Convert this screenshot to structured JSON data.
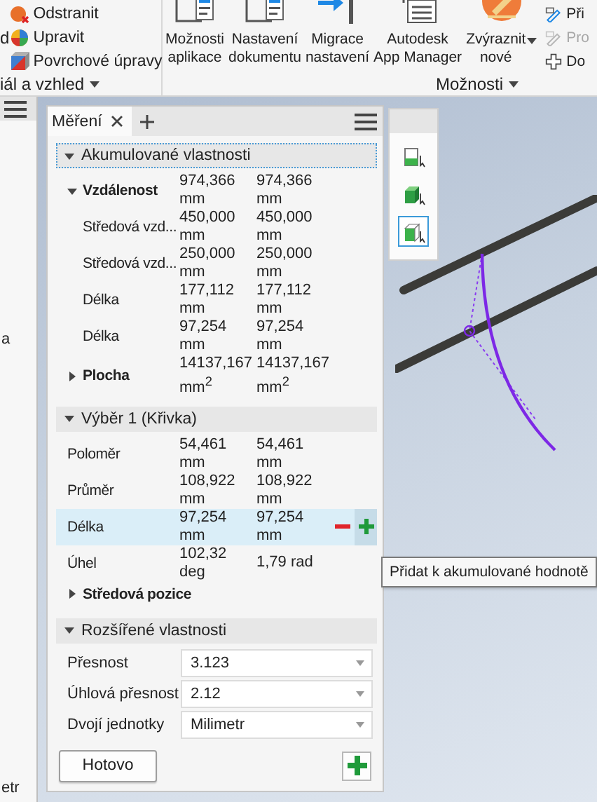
{
  "ribbon": {
    "material_group": {
      "cut_text": "d",
      "label": "iál a vzhled",
      "items": [
        {
          "label": "Odstranit",
          "kind": "remove"
        },
        {
          "label": "Upravit",
          "kind": "edit"
        },
        {
          "label": "Povrchové úpravy",
          "kind": "finish"
        }
      ]
    },
    "options_group": {
      "label": "Možnosti",
      "buttons": [
        {
          "label": "Možnosti\naplikace",
          "kind": "app-options",
          "dropdown": false
        },
        {
          "label": "Nastavení\ndokumentu",
          "kind": "doc-settings",
          "dropdown": false
        },
        {
          "label": "Migrace\nnastavení",
          "kind": "migrate",
          "dropdown": false
        },
        {
          "label": "Autodesk\nApp Manager",
          "kind": "app-manager",
          "dropdown": false
        },
        {
          "label": "Zvýraznit\nnové",
          "kind": "highlight",
          "dropdown": true
        }
      ],
      "side_items": [
        {
          "label": "Při",
          "kind": "link",
          "disabled": false
        },
        {
          "label": "Pro",
          "kind": "link",
          "disabled": true
        },
        {
          "label": "Do",
          "kind": "add",
          "disabled": false
        }
      ]
    }
  },
  "browser": {
    "texts": [
      "a",
      "etr"
    ]
  },
  "measure_panel": {
    "tabs": [
      {
        "label": "Měření",
        "selected": true
      }
    ],
    "sections": [
      {
        "title": "Akumulované vlastnosti",
        "expanded": true,
        "focused": true,
        "rows": [
          {
            "label": "Vzdálenost",
            "kind": "group",
            "expanded": true,
            "selected": false,
            "value_1": "974,366\nmm",
            "value_2": "974,366\nmm",
            "children": [
              {
                "label": "Středová vzd...",
                "kind": "value",
                "selected": false,
                "value_1": "450,000\nmm",
                "value_2": "450,000\nmm"
              },
              {
                "label": "Středová vzd...",
                "kind": "value",
                "selected": false,
                "value_1": "250,000\nmm",
                "value_2": "250,000\nmm"
              },
              {
                "label": "Délka",
                "kind": "value",
                "selected": false,
                "value_1": "177,112\nmm",
                "value_2": "177,112\nmm"
              },
              {
                "label": "Délka",
                "kind": "value",
                "selected": false,
                "value_1": "97,254\nmm",
                "value_2": "97,254\nmm"
              }
            ]
          },
          {
            "label": "Plocha",
            "kind": "group",
            "expanded": false,
            "selected": false,
            "value_1": "14137,167\nmm$^{2}$",
            "value_2": "14137,167\nmm$^{2}$"
          }
        ]
      },
      {
        "title": "Výběr 1 (Křivka)",
        "expanded": true,
        "focused": false,
        "rows": [
          {
            "label": "Poloměr",
            "kind": "value",
            "selected": false,
            "value_1": "54,461\nmm",
            "value_2": "54,461\nmm"
          },
          {
            "label": "Průměr",
            "kind": "value",
            "selected": false,
            "value_1": "108,922\nmm",
            "value_2": "108,922\nmm"
          },
          {
            "label": "Délka",
            "kind": "value",
            "selected": true,
            "value_1": "97,254\nmm",
            "value_2": "97,254\nmm"
          },
          {
            "label": "Úhel",
            "kind": "value",
            "selected": false,
            "value_1": "102,32\ndeg",
            "value_2": "1,79 rad"
          },
          {
            "label": "Středová pozice",
            "kind": "group",
            "expanded": false,
            "selected": false
          }
        ]
      }
    ],
    "settings": {
      "title": "Rozšířené vlastnosti",
      "expanded": true,
      "fields": [
        {
          "label": "Přesnost",
          "value": "3.123"
        },
        {
          "label": "Úhlová přesnost",
          "value": "2.12"
        },
        {
          "label": "Dvojí jednotky",
          "value": "Milimetr"
        }
      ]
    },
    "done_button": "Hotovo"
  },
  "view_toolbar": [
    {
      "kind": "edge",
      "selected": false
    },
    {
      "kind": "body",
      "selected": false
    },
    {
      "kind": "face",
      "selected": true
    }
  ],
  "tooltip": "Přidat k akumulované hodnotě"
}
